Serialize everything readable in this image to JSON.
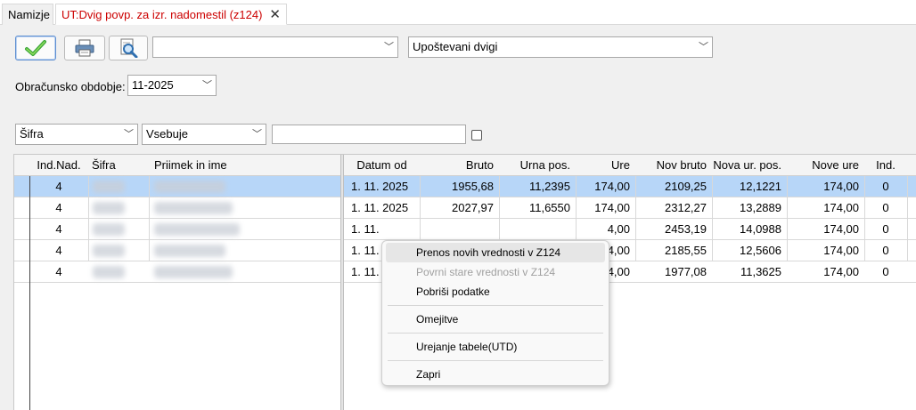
{
  "tabs": [
    {
      "label": "Namizje"
    },
    {
      "label": "UT:Dvig povp. za izr. nadomestil (z124)"
    }
  ],
  "toolbar": {
    "combo1_value": "",
    "combo2_value": "Upoštevani dvigi"
  },
  "period": {
    "label": "Obračunsko obdobje:",
    "value": "11-2025"
  },
  "filter": {
    "field": "Šifra",
    "operator": "Vsebuje",
    "search_value": "",
    "checkbox_checked": false
  },
  "grid": {
    "left_columns": [
      "Ind.Nad.",
      "Šifra",
      "Priimek in ime"
    ],
    "right_columns": [
      "Datum od",
      "Bruto",
      "Urna pos.",
      "Ure",
      "Nov bruto",
      "Nova ur. pos.",
      "Nove ure",
      "Ind."
    ],
    "selected_row": 0,
    "rows": [
      {
        "ind_nad": "4",
        "datum": "1. 11. 2025",
        "bruto": "1955,68",
        "urna": "11,2395",
        "ure": "174,00",
        "nov_bruto": "2109,25",
        "nova_urna": "12,1221",
        "nove_ure": "174,00",
        "ind": "0"
      },
      {
        "ind_nad": "4",
        "datum": "1. 11. 2025",
        "bruto": "2027,97",
        "urna": "11,6550",
        "ure": "174,00",
        "nov_bruto": "2312,27",
        "nova_urna": "13,2889",
        "nove_ure": "174,00",
        "ind": "0"
      },
      {
        "ind_nad": "4",
        "datum": "1. 11.",
        "bruto": "",
        "urna": "",
        "ure": "4,00",
        "nov_bruto": "2453,19",
        "nova_urna": "14,0988",
        "nove_ure": "174,00",
        "ind": "0"
      },
      {
        "ind_nad": "4",
        "datum": "1. 11.",
        "bruto": "",
        "urna": "",
        "ure": "4,00",
        "nov_bruto": "2185,55",
        "nova_urna": "12,5606",
        "nove_ure": "174,00",
        "ind": "0"
      },
      {
        "ind_nad": "4",
        "datum": "1. 11.",
        "bruto": "",
        "urna": "",
        "ure": "4,00",
        "nov_bruto": "1977,08",
        "nova_urna": "11,3625",
        "nove_ure": "174,00",
        "ind": "0"
      }
    ]
  },
  "context_menu": {
    "items": [
      {
        "label": "Prenos novih vrednosti v Z124",
        "state": "hover"
      },
      {
        "label": "Povrni stare vrednosti v Z124",
        "state": "disabled"
      },
      {
        "label": "Pobriši podatke",
        "state": "normal"
      },
      {
        "label": "Omejitve",
        "state": "normal"
      },
      {
        "label": "Urejanje tabele(UTD)",
        "state": "normal"
      },
      {
        "label": "Zapri",
        "state": "normal"
      }
    ]
  },
  "icons": {
    "ok": "checkmark-icon",
    "print": "printer-icon",
    "preview": "print-preview-icon",
    "close": "close-icon",
    "dropdown": "chevron-down-icon"
  },
  "colors": {
    "accent_tab": "#cc0000",
    "selection": "#b7d6f8",
    "check_green": "#3aa53a"
  }
}
